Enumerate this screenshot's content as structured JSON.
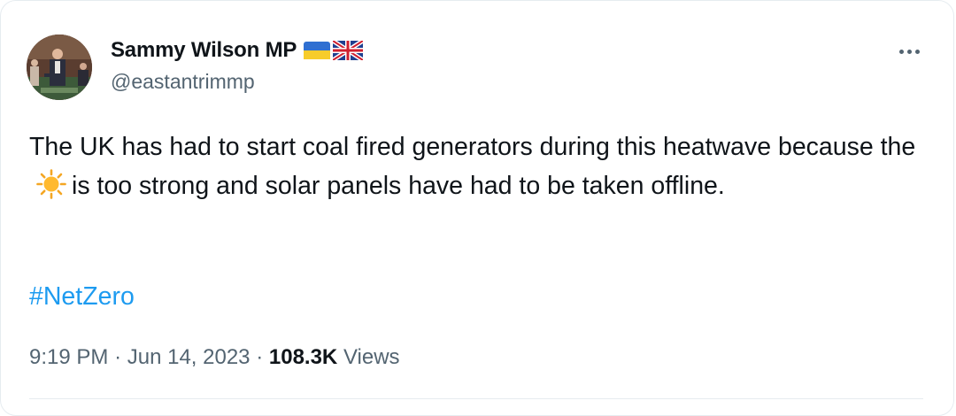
{
  "author": {
    "display_name": "Sammy Wilson MP",
    "handle": "@eastantrimmp",
    "flags": [
      "ukraine-flag",
      "uk-flag"
    ]
  },
  "tweet": {
    "text_before_emoji": "The UK has had to start coal fired generators during this heatwave because the",
    "emoji": "sun-emoji",
    "text_after_emoji": "is too strong and solar panels have had to be taken offline.",
    "hashtag": "#NetZero"
  },
  "meta": {
    "time": "9:19 PM",
    "sep1": "·",
    "date": "Jun 14, 2023",
    "sep2": "·",
    "views_count": "108.3K",
    "views_label": "Views"
  },
  "colors": {
    "text": "#0f1419",
    "secondary": "#536471",
    "link": "#1d9bf0",
    "border": "#e6ecf0"
  }
}
